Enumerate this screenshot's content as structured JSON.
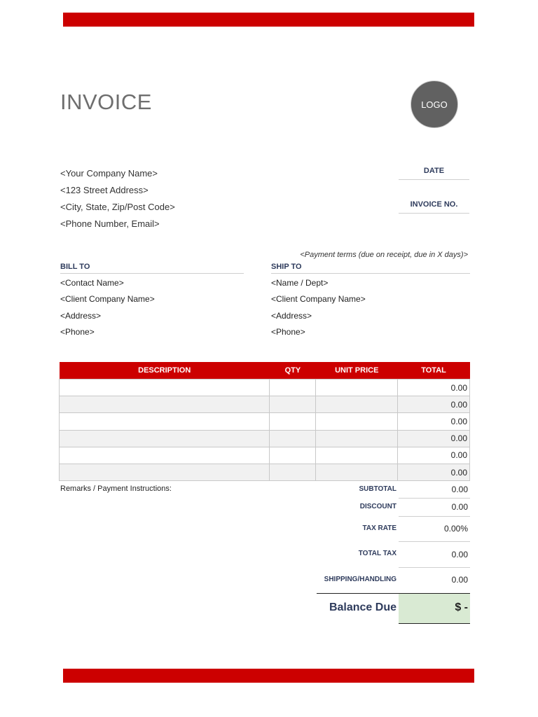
{
  "colors": {
    "accent": "#cc0000",
    "label": "#2e3b5c",
    "balance_bg": "#d9ead3",
    "row_alt": "#f1f1f1"
  },
  "header": {
    "title": "INVOICE",
    "logo": "LOGO"
  },
  "company": [
    "<Your Company Name>",
    "<123 Street Address>",
    "<City, State, Zip/Post Code>",
    "<Phone Number, Email>"
  ],
  "meta": {
    "date_label": "DATE",
    "invoice_no_label": "INVOICE NO."
  },
  "payment_terms": "<Payment terms (due on receipt, due in X days)>",
  "bill_to": {
    "heading": "BILL TO",
    "lines": [
      "<Contact Name>",
      "<Client Company Name>",
      "<Address>",
      "<Phone>"
    ]
  },
  "ship_to": {
    "heading": "SHIP TO",
    "lines": [
      "<Name / Dept>",
      "<Client Company Name>",
      "<Address>",
      "<Phone>"
    ]
  },
  "items": {
    "headers": [
      "DESCRIPTION",
      "QTY",
      "UNIT PRICE",
      "TOTAL"
    ],
    "rows": [
      {
        "description": "",
        "qty": "",
        "unit_price": "",
        "total": "0.00"
      },
      {
        "description": "",
        "qty": "",
        "unit_price": "",
        "total": "0.00"
      },
      {
        "description": "",
        "qty": "",
        "unit_price": "",
        "total": "0.00"
      },
      {
        "description": "",
        "qty": "",
        "unit_price": "",
        "total": "0.00"
      },
      {
        "description": "",
        "qty": "",
        "unit_price": "",
        "total": "0.00"
      },
      {
        "description": "",
        "qty": "",
        "unit_price": "",
        "total": "0.00"
      }
    ]
  },
  "remarks_label": "Remarks / Payment Instructions:",
  "summary": {
    "subtotal_label": "SUBTOTAL",
    "subtotal": "0.00",
    "discount_label": "DISCOUNT",
    "discount": "0.00",
    "tax_rate_label": "TAX RATE",
    "tax_rate": "0.00%",
    "total_tax_label": "TOTAL TAX",
    "total_tax": "0.00",
    "shipping_label": "SHIPPING/HANDLING",
    "shipping": "0.00",
    "balance_label": "Balance Due",
    "balance": "$ -"
  }
}
